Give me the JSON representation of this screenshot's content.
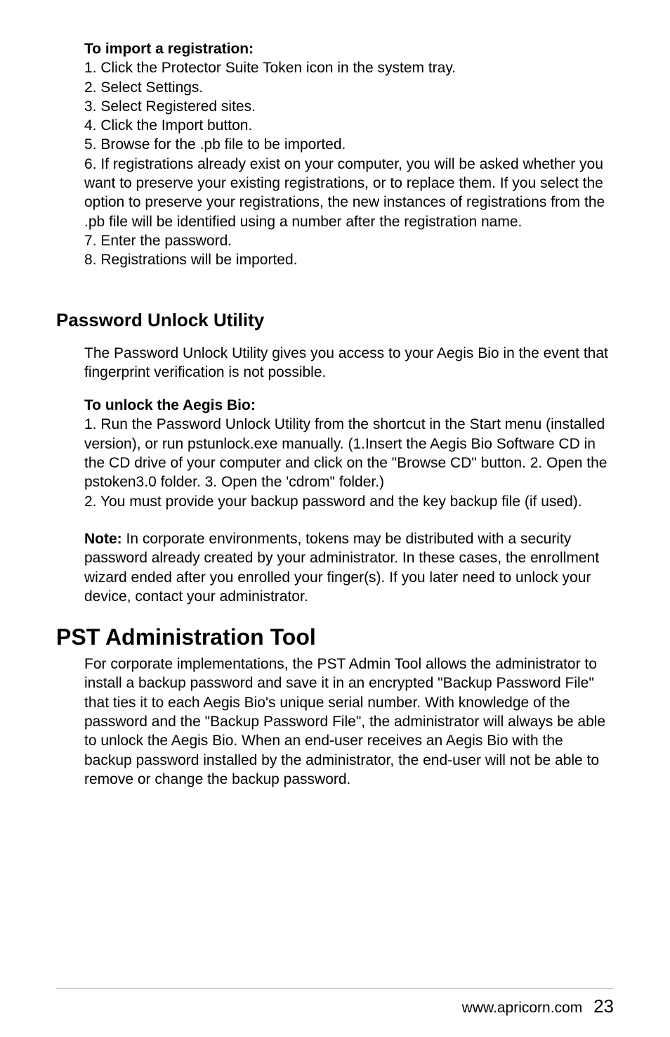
{
  "import_section": {
    "heading": "To import a registration:",
    "l1": "1.   Click the Protector Suite Token icon in the system tray.",
    "l2": "2.   Select Settings.",
    "l3": "3.   Select Registered sites.",
    "l4": "4.   Click the Import button.",
    "l5": "5.   Browse for the .pb file to be imported.",
    "l6": "6.   If registrations already exist on your computer, you will be asked whether you want to preserve your existing registrations, or to replace them. If you select the option to preserve your registrations, the new instances of registrations from the .pb file will be identified using a number after the registration name.",
    "l7": "7.   Enter the password.",
    "l8": "8.   Registrations will be imported."
  },
  "unlock_util": {
    "heading": "Password Unlock Utility",
    "intro": "The Password Unlock Utility gives you access to your Aegis Bio in the event that fingerprint verification is not possible.",
    "sub_heading": "To unlock the Aegis Bio:",
    "l1": "1.   Run the Password Unlock Utility from the shortcut in the Start menu (installed version), or run pstunlock.exe manually. (1.Insert the Aegis Bio Software CD in the CD drive of your computer and click on the \"Browse CD\" button. 2. Open the pstoken3.0 folder.           3. Open the 'cdrom\" folder.)",
    "l2": "2.   You must provide your backup password and the key backup file (if used).",
    "note_label": "Note:",
    "note_body": " In corporate environments, tokens may be distributed with a security password already created by your administrator. In these cases, the enrollment wizard ended after you enrolled your finger(s). If you later need to unlock your device, contact your administrator."
  },
  "pst_admin": {
    "heading": "PST Administration Tool",
    "body": "For corporate implementations, the PST Admin Tool allows the administrator to install a backup password and save it in an encrypted \"Backup Password File\" that ties it to each Aegis Bio's unique serial number.  With knowledge of the password and the \"Backup Password File\", the administrator will always be able to unlock the Aegis Bio.  When an end-user receives an Aegis Bio with the backup password installed by the administrator, the end-user will not be able to remove or change the backup password."
  },
  "footer": {
    "url": "www.apricorn.com",
    "page": "23"
  }
}
